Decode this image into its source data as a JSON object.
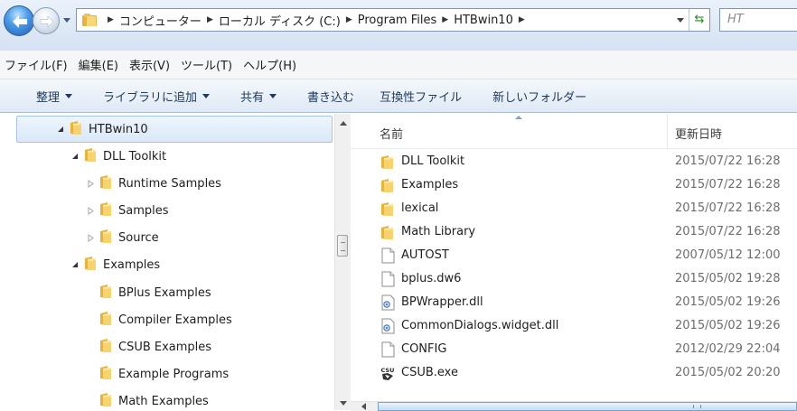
{
  "address": {
    "crumbs": [
      "コンピューター",
      "ローカル ディスク (C:)",
      "Program Files",
      "HTBwin10"
    ],
    "search_placeholder": "HT"
  },
  "menu": [
    "ファイル(F)",
    "編集(E)",
    "表示(V)",
    "ツール(T)",
    "ヘルプ(H)"
  ],
  "commands": {
    "organize": "整理",
    "add_to_library": "ライブラリに追加",
    "share": "共有",
    "burn": "書き込む",
    "compat_files": "互換性ファイル",
    "new_folder": "新しいフォルダー"
  },
  "tree": [
    {
      "label": "HTBwin10",
      "state": "expanded",
      "selected": true
    },
    {
      "label": "DLL Toolkit",
      "state": "expanded",
      "selected": false
    },
    {
      "label": "Runtime Samples",
      "state": "collapsed",
      "selected": false
    },
    {
      "label": "Samples",
      "state": "collapsed",
      "selected": false
    },
    {
      "label": "Source",
      "state": "collapsed",
      "selected": false
    },
    {
      "label": "Examples",
      "state": "expanded",
      "selected": false
    },
    {
      "label": "BPlus Examples",
      "state": "none",
      "selected": false
    },
    {
      "label": "Compiler Examples",
      "state": "none",
      "selected": false
    },
    {
      "label": "CSUB Examples",
      "state": "none",
      "selected": false
    },
    {
      "label": "Example Programs",
      "state": "none",
      "selected": false
    },
    {
      "label": "Math Examples",
      "state": "none",
      "selected": false
    }
  ],
  "columns": {
    "name": "名前",
    "date": "更新日時"
  },
  "files": [
    {
      "name": "DLL Toolkit",
      "date": "2015/07/22 16:28",
      "icon": "folder-icon"
    },
    {
      "name": "Examples",
      "date": "2015/07/22 16:28",
      "icon": "folder-icon"
    },
    {
      "name": "lexical",
      "date": "2015/07/22 16:28",
      "icon": "folder-icon"
    },
    {
      "name": "Math Library",
      "date": "2015/07/22 16:28",
      "icon": "folder-icon"
    },
    {
      "name": "AUTOST",
      "date": "2007/05/12 12:00",
      "icon": "file-icon"
    },
    {
      "name": "bplus.dw6",
      "date": "2015/05/02 19:28",
      "icon": "file-icon"
    },
    {
      "name": "BPWrapper.dll",
      "date": "2015/05/02 19:26",
      "icon": "dll-icon"
    },
    {
      "name": "CommonDialogs.widget.dll",
      "date": "2015/05/02 19:26",
      "icon": "dll-icon"
    },
    {
      "name": "CONFIG",
      "date": "2012/02/29 22:04",
      "icon": "file-icon"
    },
    {
      "name": "CSUB.exe",
      "date": "2015/05/02 20:20",
      "icon": "exe-icon"
    }
  ],
  "colors": {
    "folder": "#f2c24e",
    "selection": "#d9e8f8",
    "command_text": "#1e395b"
  }
}
